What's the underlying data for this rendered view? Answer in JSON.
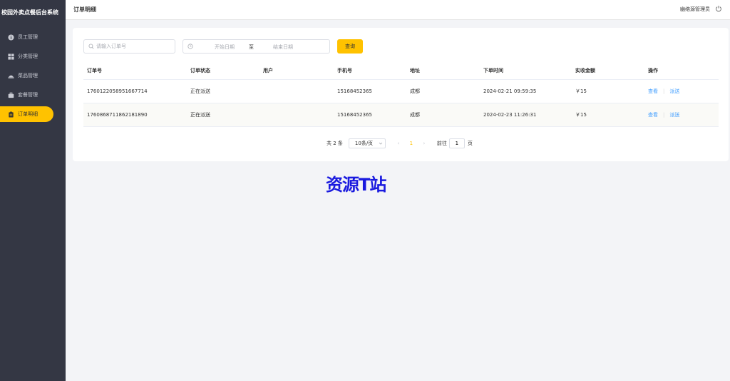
{
  "app": {
    "title": "校园外卖点餐后台系统"
  },
  "sidebar": {
    "items": [
      {
        "label": "员工管理",
        "icon": "info-circle-icon",
        "active": false
      },
      {
        "label": "分类管理",
        "icon": "grid-icon",
        "active": false
      },
      {
        "label": "菜品管理",
        "icon": "dish-icon",
        "active": false
      },
      {
        "label": "套餐管理",
        "icon": "briefcase-icon",
        "active": false
      },
      {
        "label": "订单明细",
        "icon": "clipboard-icon",
        "active": true
      }
    ]
  },
  "header": {
    "page_title": "订单明细",
    "user_name": "幽络源管理员",
    "logout_icon": "power-icon"
  },
  "filters": {
    "order_search_placeholder": "请输入订单号",
    "order_search_value": "",
    "start_date_placeholder": "开始日期",
    "date_separator": "至",
    "end_date_placeholder": "结束日期",
    "query_button": "查询"
  },
  "table": {
    "columns": [
      "订单号",
      "订单状态",
      "用户",
      "手机号",
      "地址",
      "下单时间",
      "实收金额",
      "操作"
    ],
    "rows": [
      {
        "order_no": "1760122058951667714",
        "status": "正在派送",
        "user": "",
        "phone": "15168452365",
        "address": "成都",
        "order_time": "2024-02-21 09:59:35",
        "amount": "￥15",
        "action_view": "查看",
        "action_dispatch": "派送"
      },
      {
        "order_no": "1760868711862181890",
        "status": "正在派送",
        "user": "",
        "phone": "15168452365",
        "address": "成都",
        "order_time": "2024-02-23 11:26:31",
        "amount": "￥15",
        "action_view": "查看",
        "action_dispatch": "派送"
      }
    ]
  },
  "pagination": {
    "total_text": "共 2 条",
    "page_size": "10条/页",
    "prev": "‹",
    "current_page": "1",
    "next": "›",
    "goto_label": "前往",
    "goto_value": "1",
    "page_unit": "页"
  },
  "watermark": {
    "text": "资源T站"
  },
  "colors": {
    "accent": "#ffc200",
    "sidebar_bg": "#343744",
    "link": "#419eff"
  }
}
